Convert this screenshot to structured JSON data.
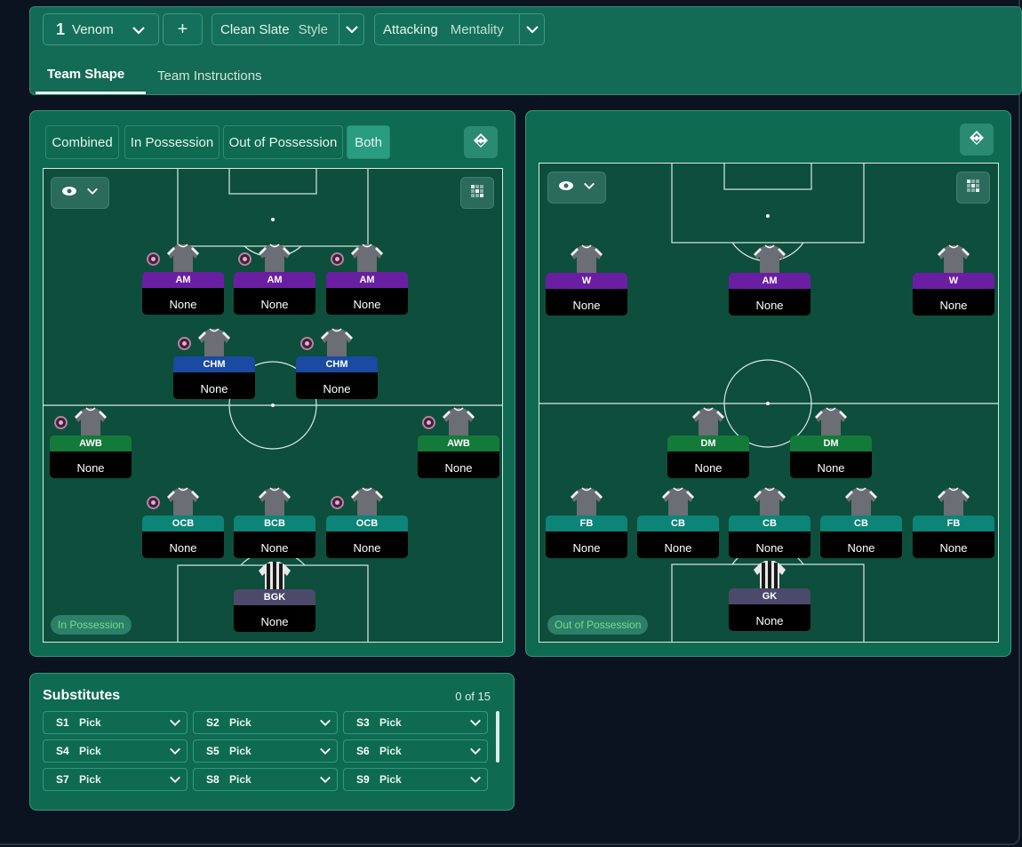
{
  "header": {
    "tactic_number": "1",
    "tactic_name": "Venom",
    "add_label": "+",
    "style_value": "Clean Slate",
    "style_label": "Style",
    "mentality_value": "Attacking",
    "mentality_label": "Mentality",
    "tabs": [
      {
        "label": "Team Shape",
        "active": true
      },
      {
        "label": "Team Instructions",
        "active": false
      }
    ]
  },
  "left_panel": {
    "segments": [
      {
        "label": "Combined",
        "active": false
      },
      {
        "label": "In Possession",
        "active": false
      },
      {
        "label": "Out of Possession",
        "active": false
      },
      {
        "label": "Both",
        "active": true
      }
    ],
    "badge": "In Possession",
    "players": [
      {
        "role": "AM",
        "name": "None",
        "role_color": "#6a1fa2",
        "marked": true
      },
      {
        "role": "AM",
        "name": "None",
        "role_color": "#6a1fa2",
        "marked": true
      },
      {
        "role": "AM",
        "name": "None",
        "role_color": "#6a1fa2",
        "marked": true
      },
      {
        "role": "CHM",
        "name": "None",
        "role_color": "#1a4aa2",
        "marked": true
      },
      {
        "role": "CHM",
        "name": "None",
        "role_color": "#1a4aa2",
        "marked": true
      },
      {
        "role": "AWB",
        "name": "None",
        "role_color": "#137a3a",
        "marked": true
      },
      {
        "role": "AWB",
        "name": "None",
        "role_color": "#137a3a",
        "marked": true
      },
      {
        "role": "OCB",
        "name": "None",
        "role_color": "#0d8478",
        "marked": true
      },
      {
        "role": "BCB",
        "name": "None",
        "role_color": "#0d8478",
        "marked": false
      },
      {
        "role": "OCB",
        "name": "None",
        "role_color": "#0d8478",
        "marked": true
      },
      {
        "role": "BGK",
        "name": "None",
        "role_color": "#4b4a6a",
        "marked": false
      }
    ]
  },
  "right_panel": {
    "badge": "Out of Possession",
    "players": [
      {
        "role": "W",
        "name": "None"
      },
      {
        "role": "AM",
        "name": "None"
      },
      {
        "role": "W",
        "name": "None"
      },
      {
        "role": "DM",
        "name": "None"
      },
      {
        "role": "DM",
        "name": "None"
      },
      {
        "role": "FB",
        "name": "None"
      },
      {
        "role": "CB",
        "name": "None"
      },
      {
        "role": "CB",
        "name": "None"
      },
      {
        "role": "CB",
        "name": "None"
      },
      {
        "role": "FB",
        "name": "None"
      },
      {
        "role": "GK",
        "name": "None"
      }
    ]
  },
  "substitutes": {
    "title": "Substitutes",
    "count": "0 of 15",
    "slots": [
      {
        "code": "S1",
        "value": "Pick"
      },
      {
        "code": "S2",
        "value": "Pick"
      },
      {
        "code": "S3",
        "value": "Pick"
      },
      {
        "code": "S4",
        "value": "Pick"
      },
      {
        "code": "S5",
        "value": "Pick"
      },
      {
        "code": "S6",
        "value": "Pick"
      },
      {
        "code": "S7",
        "value": "Pick"
      },
      {
        "code": "S8",
        "value": "Pick"
      },
      {
        "code": "S9",
        "value": "Pick"
      }
    ]
  },
  "icons": {
    "chevron": "chevron-down-icon",
    "eye": "eye-icon",
    "grid": "grid-icon",
    "swap": "swap-icon",
    "shirt": "shirt-icon"
  },
  "colors": {
    "panel": "#0f6a52",
    "pitch": "#0d4e3c",
    "background": "#0b1220",
    "badge_text": "#6ee08a"
  }
}
